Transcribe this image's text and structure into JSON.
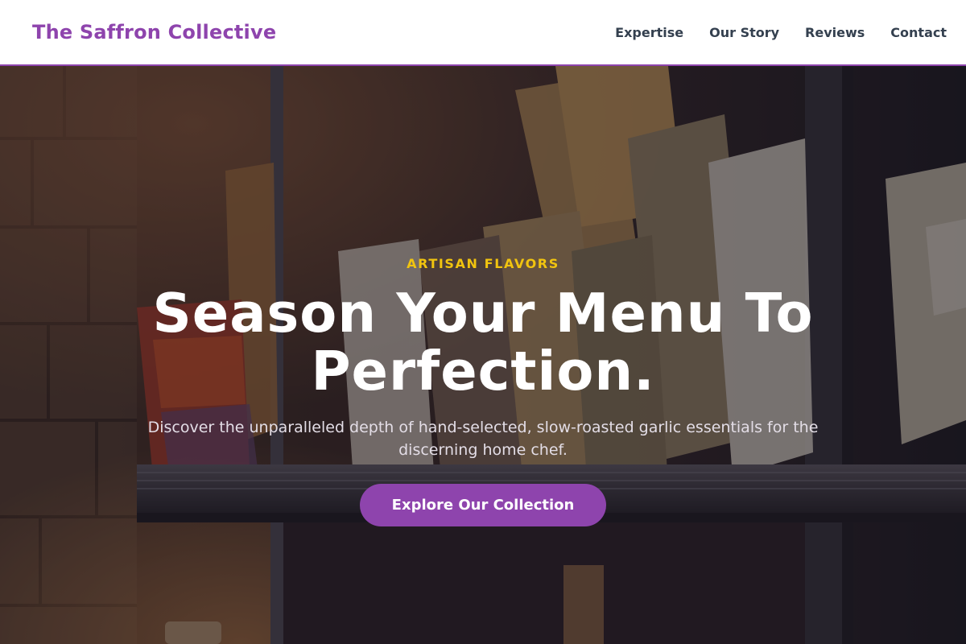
{
  "site": {
    "brand": "The Saffron Collective"
  },
  "nav": {
    "links": [
      "Expertise",
      "Our Story",
      "Reviews",
      "Contact"
    ]
  },
  "hero": {
    "eyebrow": "ARTISAN FLAVORS",
    "headline": "Season Your Menu To Perfection.",
    "subheadline": "Discover the unparalleled depth of hand-selected, slow-roasted garlic essentials for the discerning home chef.",
    "cta_label": "Explore Our Collection",
    "image_subject": "pantry shelves of packaged artisan pasta"
  },
  "colors": {
    "brand": "#8e44ad",
    "accent": "#f1c40f",
    "nav_text": "#34404f",
    "headline": "#ffffff"
  }
}
